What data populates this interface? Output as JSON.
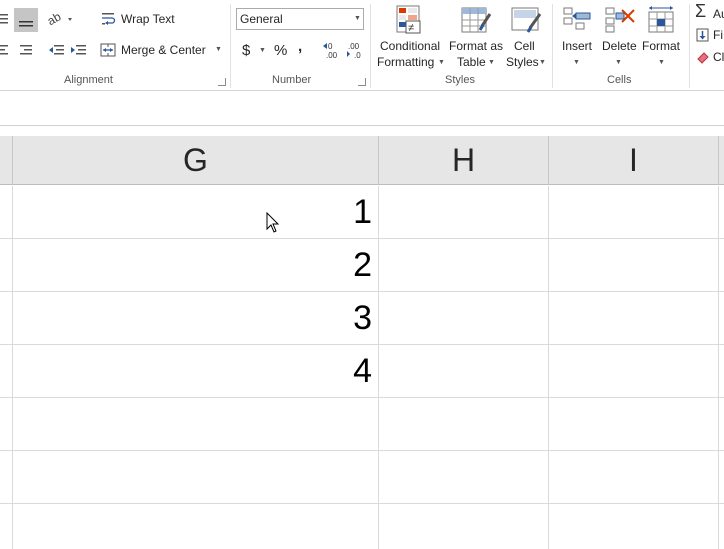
{
  "ribbon": {
    "alignment": {
      "wrap_text": "Wrap Text",
      "merge_center": "Merge & Center",
      "group_label": "Alignment"
    },
    "number": {
      "format_value": "General",
      "currency": "$",
      "percent": "%",
      "comma": ",",
      "inc_decimal": ".00",
      "dec_decimal": ".00",
      "group_label": "Number"
    },
    "styles": {
      "conditional_1": "Conditional",
      "conditional_2": "Formatting",
      "format_table_1": "Format as",
      "format_table_2": "Table",
      "cell_styles_1": "Cell",
      "cell_styles_2": "Styles",
      "group_label": "Styles"
    },
    "cells": {
      "insert": "Insert",
      "delete": "Delete",
      "format": "Format",
      "group_label": "Cells"
    },
    "editing": {
      "autosum": "Au",
      "fill": "Fi",
      "clear": "Cl"
    }
  },
  "sheet": {
    "columns": [
      "G",
      "H",
      "I"
    ],
    "column_g_values": [
      "1",
      "2",
      "3",
      "4"
    ]
  },
  "colors": {
    "header_bg": "#e6e6e6",
    "gridline": "#dadada",
    "accent_red": "#d83b01",
    "accent_blue": "#2b579a"
  }
}
